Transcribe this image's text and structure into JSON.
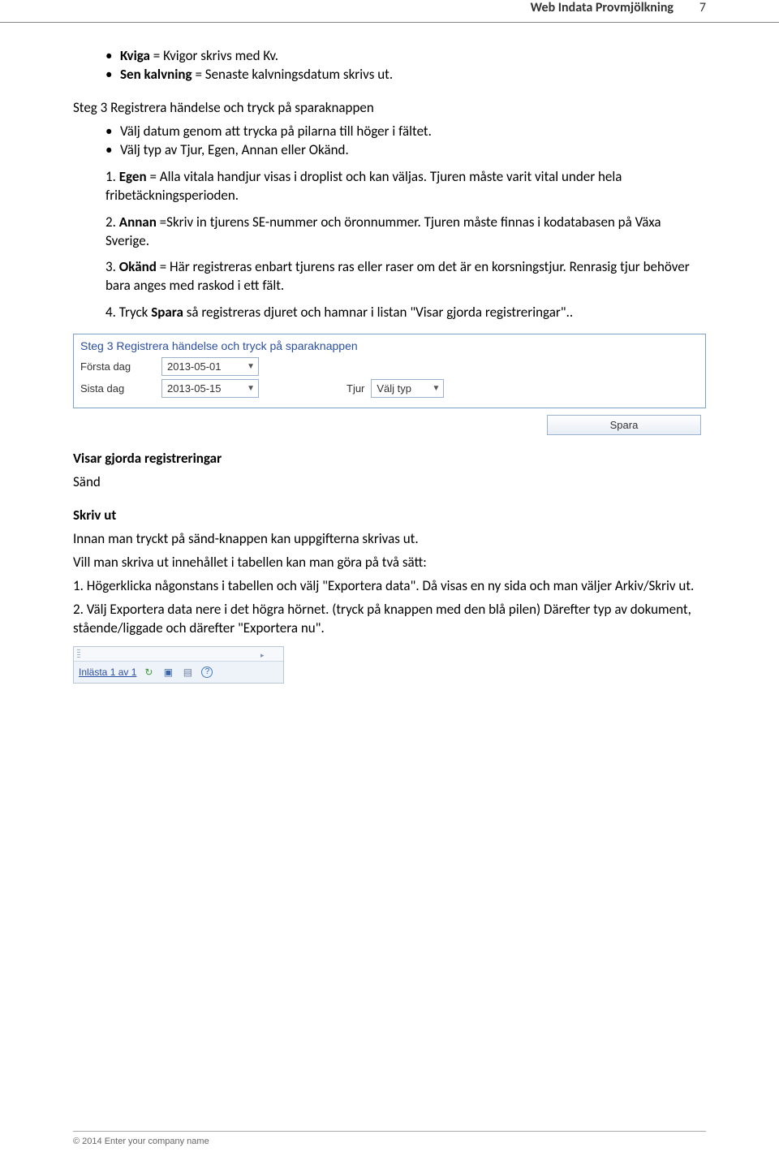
{
  "header": {
    "title": "Web Indata Provmjölkning",
    "page_number": "7"
  },
  "bullets_top": [
    {
      "label": "Kviga",
      "text": " = Kvigor skrivs med Kv."
    },
    {
      "label": "Sen kalvning",
      "text": " = Senaste kalvningsdatum skrivs ut."
    }
  ],
  "step3_heading": "Steg 3 Registrera händelse och tryck på sparaknappen",
  "step3_bullets": [
    "Välj datum genom att trycka på pilarna till höger i fältet.",
    "Välj typ av Tjur, Egen, Annan eller Okänd."
  ],
  "numbered": [
    {
      "n": "1.",
      "label": "Egen",
      "text": " = Alla vitala handjur visas i droplist och kan väljas. Tjuren måste varit vital under hela fribetäckningsperioden."
    },
    {
      "n": "2.",
      "label": "Annan",
      "text": " =Skriv in tjurens SE-nummer och öronnummer. Tjuren måste finnas i kodatabasen på Växa Sverige."
    },
    {
      "n": "3.",
      "label": "Okänd",
      "text": " = Här registreras enbart tjurens ras eller raser om det är en korsningstjur. Renrasig tjur behöver bara anges med raskod i ett fält."
    },
    {
      "n": "4.",
      "prefix": "Tryck ",
      "label": "Spara",
      "text": " så registreras djuret och hamnar i listan \"Visar gjorda registreringar\".."
    }
  ],
  "form": {
    "title": "Steg 3 Registrera händelse och tryck på sparaknappen",
    "first_day_label": "Första dag",
    "first_day_value": "2013-05-01",
    "last_day_label": "Sista dag",
    "last_day_value": "2013-05-15",
    "tjur_label": "Tjur",
    "tjur_value": "Välj typ",
    "save_label": "Spara"
  },
  "visar_heading": "Visar gjorda registreringar",
  "sand": "Sänd",
  "skrivut_heading": "Skriv ut",
  "skrivut_intro": "Innan man tryckt på sänd-knappen kan uppgifterna skrivas ut.",
  "skrivut_line2": "Vill man skriva ut innehållet i tabellen kan man göra på två sätt:",
  "skrivut_items": [
    "1. Högerklicka någonstans i tabellen och välj \"Exportera data\". Då visas en ny sida och man väljer Arkiv/Skriv ut.",
    "2. Välj Exportera data nere i det högra hörnet. (tryck på knappen med den blå pilen) Därefter typ av dokument, stående/liggade och därefter \"Exportera nu\"."
  ],
  "toolbar_status": "Inlästa 1 av 1",
  "footer": "© 2014 Enter your company name"
}
